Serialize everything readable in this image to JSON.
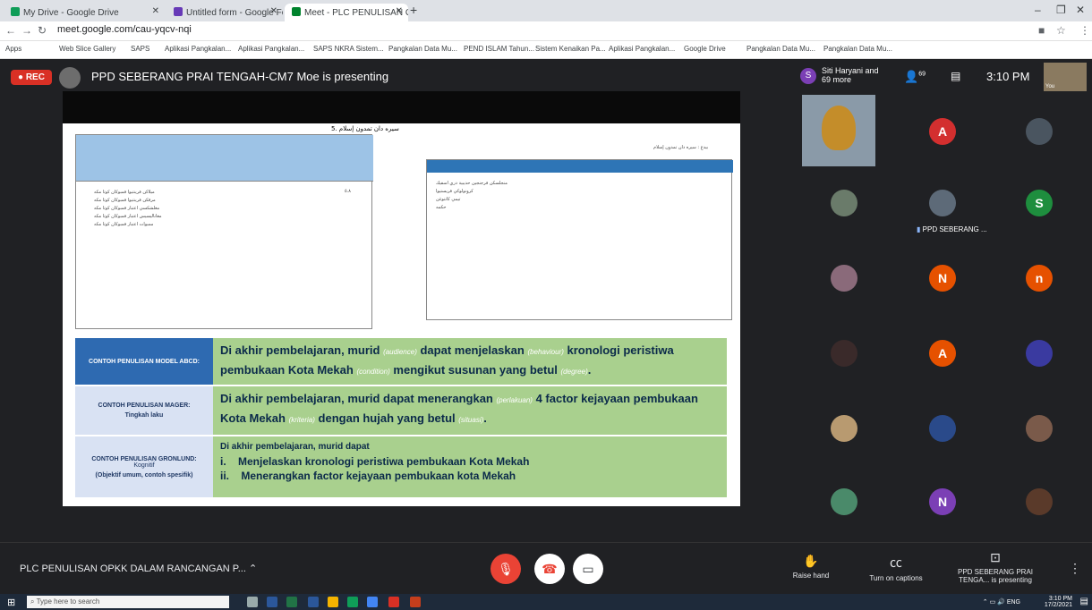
{
  "tabs": [
    {
      "label": "My Drive - Google Drive",
      "color": "#0f9d58"
    },
    {
      "label": "Untitled form - Google Forms",
      "color": "#673ab7"
    },
    {
      "label": "Meet - PLC PENULISAN OPK",
      "color": "#00832d"
    }
  ],
  "address": {
    "url": "meet.google.com/cau-yqcv-nqi"
  },
  "bookmarks": [
    "Apps",
    "Web Slice Gallery",
    "SAPS",
    "Aplikasi Pangkalan...",
    "Aplikasi Pangkalan...",
    "SAPS NKRA Sistem...",
    "Pangkalan Data Mu...",
    "PEND ISLAM Tahun...",
    "Sistem Kenaikan Pa...",
    "Aplikasi Pangkalan...",
    "Google Drive",
    "Pangkalan Data Mu...",
    "Pangkalan Data Mu..."
  ],
  "meet": {
    "rec": "REC",
    "presenting_title": "PPD SEBERANG PRAI TENGAH-CM7 Moe is presenting",
    "participants_summary": "Siti Haryani and 69 more",
    "participant_count": "69",
    "time": "3:10 PM",
    "you_label": "You",
    "pinned_name": "PPD SEBERANG ..."
  },
  "slide": {
    "heading": "5. سيره دان تمدون إسلام",
    "right_heading": "بيدغ : سيره دان تمدون إسلام",
    "rows": [
      {
        "label": "CONTOH PENULISAN MODEL ABCD:",
        "parts": [
          "Di akhir pembelajaran, murid ",
          "(audience)",
          " dapat menjelaskan ",
          "(behaviour)",
          " kronologi peristiwa pembukaan Kota Mekah ",
          "(condition)",
          " mengikut susunan yang betul ",
          "(degree)",
          "."
        ]
      },
      {
        "label": "CONTOH PENULISAN MAGER:",
        "sublabel": "Tingkah laku",
        "parts": [
          "Di akhir pembelajaran, murid dapat menerangkan ",
          "(perlakuan)",
          " 4 factor kejayaan pembukaan Kota Mekah ",
          "(kriteria)",
          " dengan hujah yang betul ",
          "(situasi)",
          "."
        ]
      },
      {
        "label": "CONTOH PENULISAN GRONLUND:",
        "sublabel": "Kognitif",
        "sublabel2": "(Objektif umum, contoh spesifik)",
        "intro": "Di akhir pembelajaran, murid dapat",
        "items": [
          "Menjelaskan kronologi peristiwa pembukaan Kota Mekah",
          "Menerangkan factor kejayaan pembukaan kota Mekah"
        ]
      }
    ]
  },
  "tiles": [
    {
      "type": "video"
    },
    {
      "letter": "A",
      "color": "#d32f2f"
    },
    {
      "type": "photo"
    },
    {
      "type": "photo"
    },
    {
      "type": "photo"
    },
    {
      "letter": "S",
      "color": "#1e8e3e"
    },
    {
      "type": "photo"
    },
    {
      "letter": "N",
      "color": "#e65100"
    },
    {
      "letter": "n",
      "color": "#e65100"
    },
    {
      "type": "photo"
    },
    {
      "letter": "A",
      "color": "#e65100"
    },
    {
      "type": "photo"
    },
    {
      "type": "photo"
    },
    {
      "type": "photo"
    },
    {
      "type": "photo"
    },
    {
      "type": "photo"
    },
    {
      "letter": "N",
      "color": "#7b3fb5"
    },
    {
      "type": "photo"
    }
  ],
  "controls": {
    "meeting_title": "PLC PENULISAN OPKK DALAM RANCANGAN P...",
    "raise_hand": "Raise hand",
    "captions": "Turn on captions",
    "presenting": "PPD SEBERANG PRAI TENGA... is presenting"
  },
  "taskbar": {
    "search": "Type here to search",
    "time": "3:10 PM",
    "date": "17/2/2021",
    "lang": "ENG"
  }
}
